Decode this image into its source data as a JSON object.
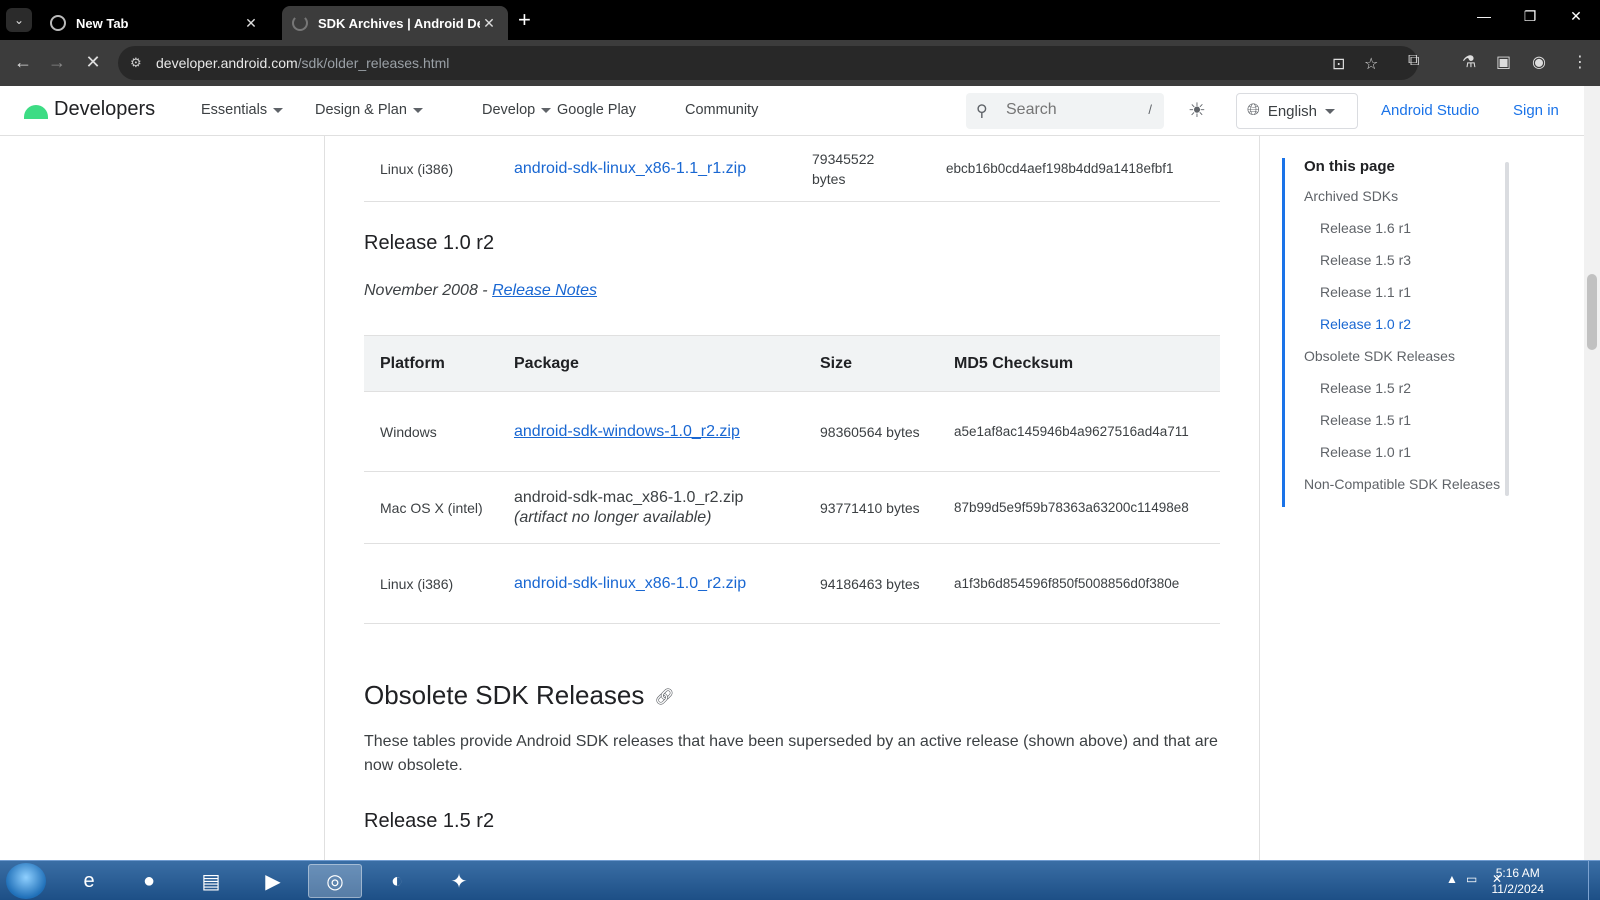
{
  "browser": {
    "tabs": [
      {
        "title": "New Tab",
        "active": false
      },
      {
        "title": "SDK Archives  |  Android Devel",
        "active": true
      }
    ],
    "url_host": "developer.android.com",
    "url_path": "/sdk/older_releases.html"
  },
  "site": {
    "logo_text": "Developers",
    "nav": [
      "Essentials",
      "Design & Plan",
      "Develop",
      "Google Play",
      "Community"
    ],
    "search_placeholder": "Search",
    "search_shortcut": "/",
    "language": "English",
    "android_studio": "Android Studio",
    "sign_in": "Sign in"
  },
  "content": {
    "top_row": {
      "platform": "Linux (i386)",
      "package": "android-sdk-linux_x86-1.1_r1.zip",
      "size_line1": "79345522",
      "size_line2": "bytes",
      "md5": "ebcb16b0cd4aef198b4dd9a1418efbf1"
    },
    "release_10r2": {
      "title": "Release 1.0 r2",
      "date": "November 2008 - ",
      "notes_link": "Release Notes",
      "headers": [
        "Platform",
        "Package",
        "Size",
        "MD5 Checksum"
      ],
      "rows": [
        {
          "platform": "Windows",
          "package": "android-sdk-windows-1.0_r2.zip",
          "size": "98360564 bytes",
          "md5": "a5e1af8ac145946b4a9627516ad4a711"
        },
        {
          "platform": "Mac OS X (intel)",
          "package": "android-sdk-mac_x86-1.0_r2.zip",
          "package_note": "(artifact no longer available)",
          "size": "93771410 bytes",
          "md5": "87b99d5e9f59b78363a63200c11498e8"
        },
        {
          "platform": "Linux (i386)",
          "package": "android-sdk-linux_x86-1.0_r2.zip",
          "size": "94186463 bytes",
          "md5": "a1f3b6d854596f850f5008856d0f380e"
        }
      ]
    },
    "obsolete": {
      "title": "Obsolete SDK Releases",
      "description": "These tables provide Android SDK releases that have been superseded by an active release (shown above) and that are now obsolete.",
      "next_release_title": "Release 1.5 r2"
    }
  },
  "toc": {
    "heading": "On this page",
    "items": [
      {
        "label": "Archived SDKs",
        "level": 1
      },
      {
        "label": "Release 1.6 r1",
        "level": 2
      },
      {
        "label": "Release 1.5 r3",
        "level": 2
      },
      {
        "label": "Release 1.1 r1",
        "level": 2
      },
      {
        "label": "Release 1.0 r2",
        "level": 2,
        "active": true
      },
      {
        "label": "Obsolete SDK Releases",
        "level": 1
      },
      {
        "label": "Release 1.5 r2",
        "level": 2
      },
      {
        "label": "Release 1.5 r1",
        "level": 2
      },
      {
        "label": "Release 1.0 r1",
        "level": 2
      },
      {
        "label": "Non-Compatible SDK Releases",
        "level": 1
      }
    ]
  },
  "taskbar": {
    "time": "5:16 AM",
    "date": "11/2/2024"
  },
  "colors": {
    "link": "#1967d2",
    "brand_green": "#3ddc84",
    "toc_accent": "#1a73e8"
  }
}
